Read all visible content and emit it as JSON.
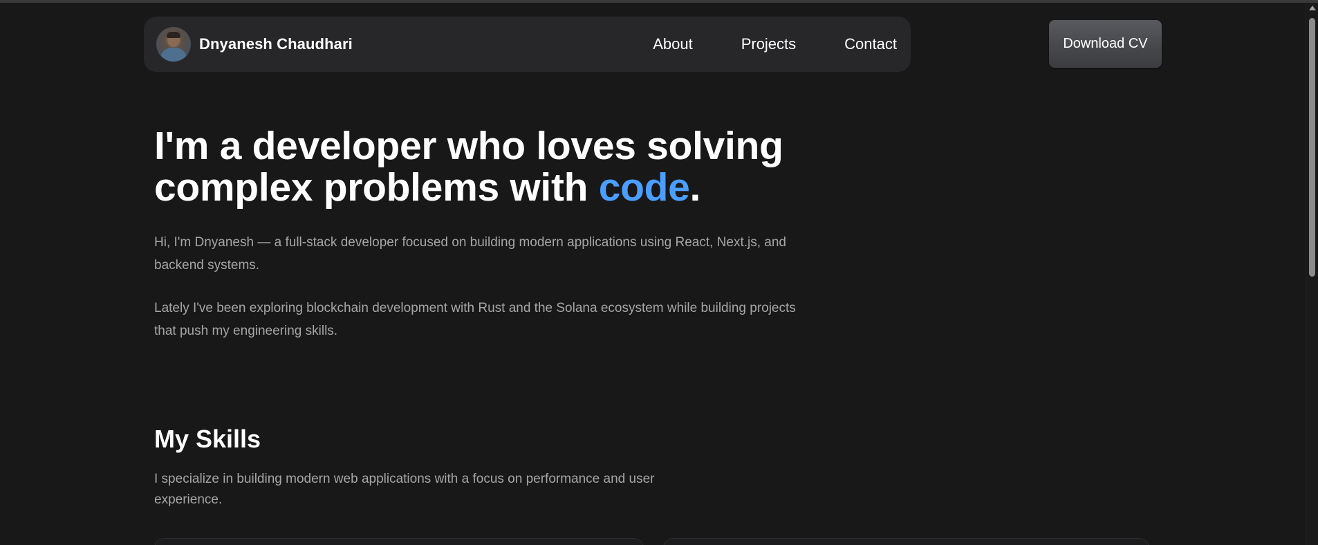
{
  "navbar": {
    "brand_name": "Dnyanesh Chaudhari",
    "links": [
      "About",
      "Projects",
      "Contact"
    ]
  },
  "cv_button": "Download CV",
  "hero": {
    "title_line1": "I'm a developer who loves solving",
    "title_line2_prefix": "complex problems with ",
    "title_accent": "code",
    "title_suffix": ".",
    "paragraph1": "Hi, I'm Dnyanesh — a full-stack developer focused on building modern applications using React, Next.js, and backend systems.",
    "paragraph2": "Lately I've been exploring blockchain development with Rust and the Solana ecosystem while building projects that push my engineering skills."
  },
  "skills": {
    "title": "My Skills",
    "description": "I specialize in building modern web applications with a focus on performance and user experience."
  },
  "colors": {
    "background": "#181818",
    "navbar": "#27272a",
    "accent": "#4b9eff",
    "muted_text": "#a6a6a6"
  },
  "icons": {
    "scroll_up": "triangle-up-icon"
  }
}
